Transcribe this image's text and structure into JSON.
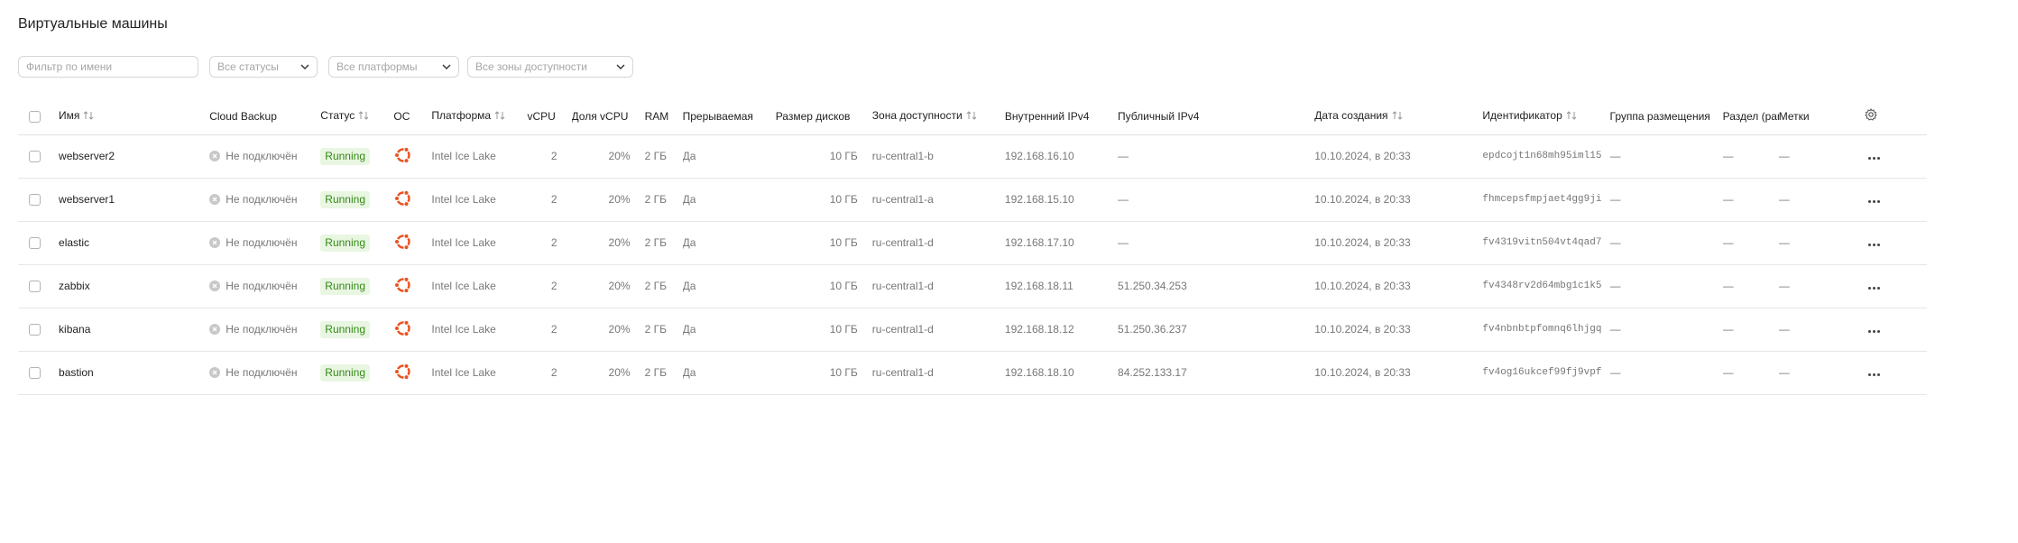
{
  "page_title": "Виртуальные машины",
  "filters": {
    "name_placeholder": "Фильтр по имени",
    "status": "Все статусы",
    "platform": "Все платформы",
    "zone": "Все зоны доступности"
  },
  "columns": {
    "name": "Имя",
    "backup": "Cloud Backup",
    "status": "Статус",
    "os": "ОС",
    "platform": "Платформа",
    "vcpu": "vCPU",
    "vcpu_share": "Доля vCPU",
    "ram": "RAM",
    "preemptible": "Прерываемая",
    "disk_size": "Размер дисков",
    "zone": "Зона доступности",
    "internal_ip": "Внутренний IPv4",
    "public_ip": "Публичный IPv4",
    "created": "Дата создания",
    "id": "Идентификатор",
    "placement_group": "Группа размещения",
    "partition": "Раздел (partition)",
    "labels": "Метки"
  },
  "rows": [
    {
      "name": "webserver2",
      "backup": "Не подключён",
      "status": "Running",
      "os": "ubuntu-icon",
      "platform": "Intel Ice Lake",
      "vcpu": "2",
      "vcpu_share": "20%",
      "ram": "2 ГБ",
      "preemptible": "Да",
      "disk": "10 ГБ",
      "zone": "ru-central1-b",
      "internal_ip": "192.168.16.10",
      "public_ip": "—",
      "created": "10.10.2024, в 20:33",
      "id": "epdcojt1n68mh95iml15",
      "placement_group": "—",
      "partition": "—",
      "labels": "—"
    },
    {
      "name": "webserver1",
      "backup": "Не подключён",
      "status": "Running",
      "os": "ubuntu-icon",
      "platform": "Intel Ice Lake",
      "vcpu": "2",
      "vcpu_share": "20%",
      "ram": "2 ГБ",
      "preemptible": "Да",
      "disk": "10 ГБ",
      "zone": "ru-central1-a",
      "internal_ip": "192.168.15.10",
      "public_ip": "—",
      "created": "10.10.2024, в 20:33",
      "id": "fhmcepsfmpjaet4gg9ji",
      "placement_group": "—",
      "partition": "—",
      "labels": "—"
    },
    {
      "name": "elastic",
      "backup": "Не подключён",
      "status": "Running",
      "os": "ubuntu-icon",
      "platform": "Intel Ice Lake",
      "vcpu": "2",
      "vcpu_share": "20%",
      "ram": "2 ГБ",
      "preemptible": "Да",
      "disk": "10 ГБ",
      "zone": "ru-central1-d",
      "internal_ip": "192.168.17.10",
      "public_ip": "—",
      "created": "10.10.2024, в 20:33",
      "id": "fv4319vitn504vt4qad7",
      "placement_group": "—",
      "partition": "—",
      "labels": "—"
    },
    {
      "name": "zabbix",
      "backup": "Не подключён",
      "status": "Running",
      "os": "ubuntu-icon",
      "platform": "Intel Ice Lake",
      "vcpu": "2",
      "vcpu_share": "20%",
      "ram": "2 ГБ",
      "preemptible": "Да",
      "disk": "10 ГБ",
      "zone": "ru-central1-d",
      "internal_ip": "192.168.18.11",
      "public_ip": "51.250.34.253",
      "created": "10.10.2024, в 20:33",
      "id": "fv4348rv2d64mbg1c1k5",
      "placement_group": "—",
      "partition": "—",
      "labels": "—"
    },
    {
      "name": "kibana",
      "backup": "Не подключён",
      "status": "Running",
      "os": "ubuntu-icon",
      "platform": "Intel Ice Lake",
      "vcpu": "2",
      "vcpu_share": "20%",
      "ram": "2 ГБ",
      "preemptible": "Да",
      "disk": "10 ГБ",
      "zone": "ru-central1-d",
      "internal_ip": "192.168.18.12",
      "public_ip": "51.250.36.237",
      "created": "10.10.2024, в 20:33",
      "id": "fv4nbnbtpfomnq6lhjgq",
      "placement_group": "—",
      "partition": "—",
      "labels": "—"
    },
    {
      "name": "bastion",
      "backup": "Не подключён",
      "status": "Running",
      "os": "ubuntu-icon",
      "platform": "Intel Ice Lake",
      "vcpu": "2",
      "vcpu_share": "20%",
      "ram": "2 ГБ",
      "preemptible": "Да",
      "disk": "10 ГБ",
      "zone": "ru-central1-d",
      "internal_ip": "192.168.18.10",
      "public_ip": "84.252.133.17",
      "created": "10.10.2024, в 20:33",
      "id": "fv4og16ukcef99fj9vpf",
      "placement_group": "—",
      "partition": "—",
      "labels": "—"
    }
  ],
  "colors": {
    "accent_os": "#e95420",
    "badge_bg": "#e9f6e2",
    "badge_text": "#348a17"
  }
}
